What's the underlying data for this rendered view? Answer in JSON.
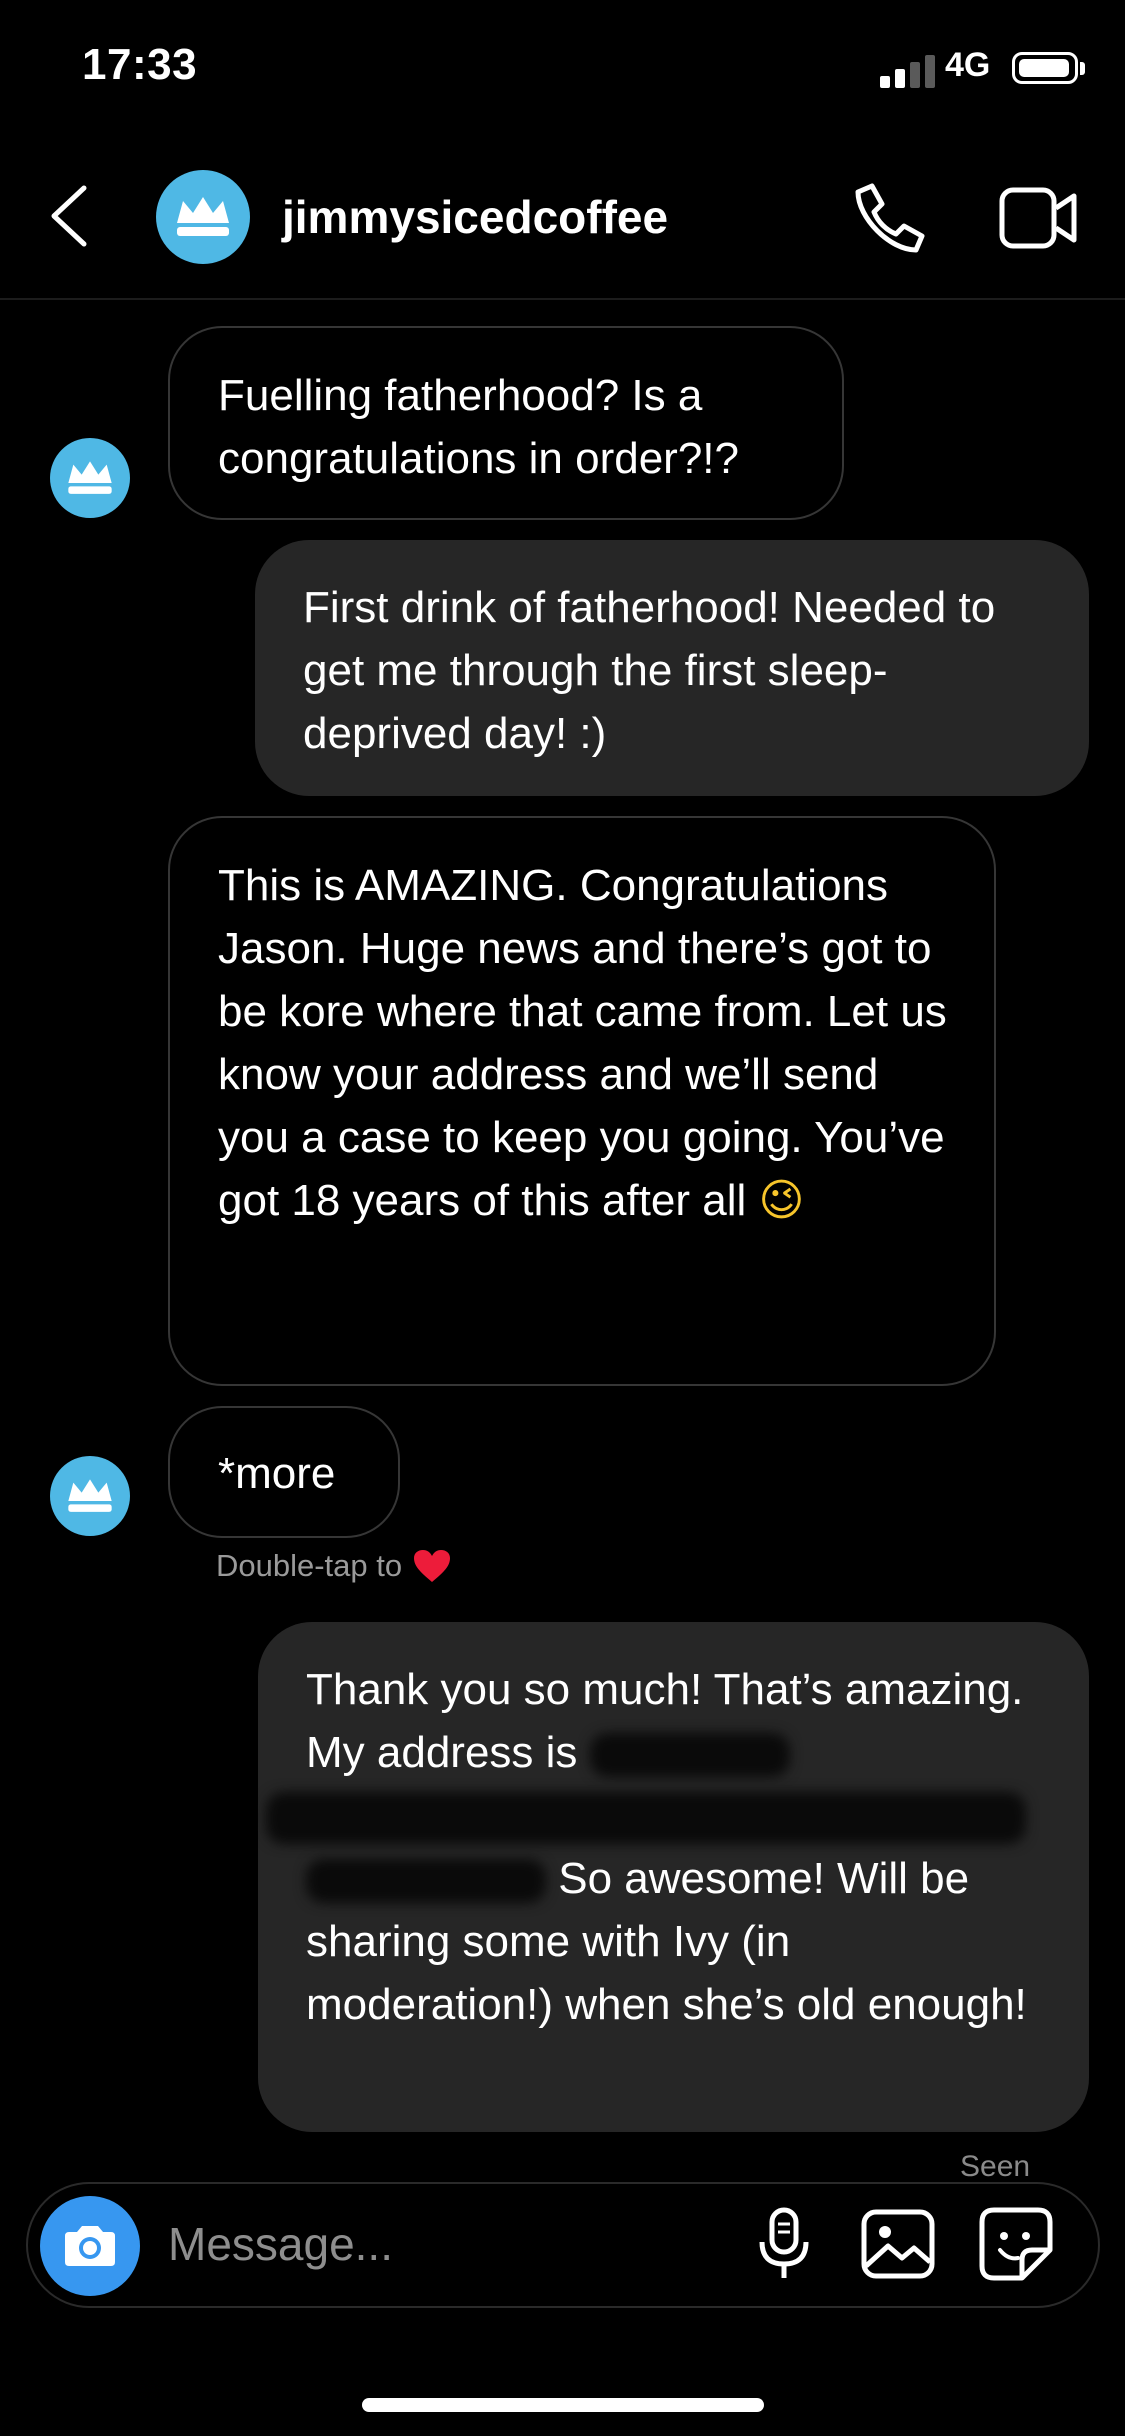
{
  "status_bar": {
    "time": "17:33",
    "network": "4G"
  },
  "header": {
    "username": "jimmysicedcoffee"
  },
  "messages": [
    {
      "text": "Fuelling fatherhood? Is a congratulations in order?!?"
    },
    {
      "text": "First drink of fatherhood! Needed to get me through the first sleep-deprived day! :)"
    },
    {
      "text": "This is AMAZING. Congratulations Jason. Huge news and there’s got to be kore where that came from. Let us know your address and we’ll send you a case to keep you going. You’ve got 18 years of this after all",
      "emoji": "😉"
    },
    {
      "text": "*more"
    },
    {
      "text_before": "Thank you so much! That’s amazing. My address is",
      "text_after": "So awesome! Will be sharing some with Ivy (in moderation!) when she’s old enough!"
    }
  ],
  "hint": {
    "label": "Double-tap to"
  },
  "seen_label": "Seen",
  "composer": {
    "placeholder": "Message..."
  },
  "colors": {
    "avatar": "#4fb8e5",
    "camera": "#3797f0",
    "outgoing_bubble": "#262626",
    "heart": "#ed1c3a"
  },
  "icons": [
    "back-chevron-icon",
    "crown-icon",
    "phone-icon",
    "video-camera-icon",
    "camera-icon",
    "microphone-icon",
    "gallery-icon",
    "sticker-icon",
    "heart-icon"
  ]
}
